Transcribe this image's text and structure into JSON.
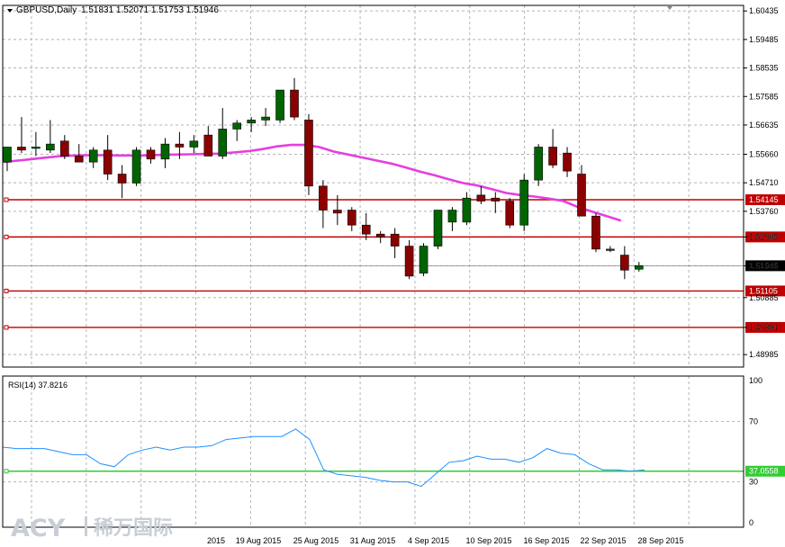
{
  "header": {
    "symbol": "GBPUSD,Daily",
    "ohlc": "1.51831 1.52071 1.51753 1.51946"
  },
  "watermark": {
    "brand": "ACY",
    "cn": "稀万国际"
  },
  "colors": {
    "bull": "#006400",
    "bear": "#8b0000",
    "ma": "#e53fe0",
    "level": "#c00000",
    "rsi": "#1e90ff",
    "rsi_level": "#33cc33",
    "grid": "#b4b4b4",
    "price_label_bg": "#c00000"
  },
  "chart_data": [
    {
      "type": "candlestick",
      "title": "GBPUSD,Daily",
      "y_ticks": [
        "1.60435",
        "1.59485",
        "1.58535",
        "1.57585",
        "1.56635",
        "1.55660",
        "1.54710",
        "1.53760",
        "1.52905",
        "1.51946",
        "1.50885",
        "1.49891",
        "1.48985"
      ],
      "ylim": [
        1.4857,
        1.6062
      ],
      "x_tick_labels": [
        "2015",
        "19 Aug 2015",
        "25 Aug 2015",
        "31 Aug 2015",
        "4 Sep 2015",
        "10 Sep 2015",
        "16 Sep 2015",
        "22 Sep 2015",
        "28 Sep 2015"
      ],
      "candles": [
        {
          "o": 1.554,
          "h": 1.559,
          "l": 1.551,
          "c": 1.559
        },
        {
          "o": 1.559,
          "h": 1.569,
          "l": 1.557,
          "c": 1.558
        },
        {
          "o": 1.559,
          "h": 1.564,
          "l": 1.556,
          "c": 1.559
        },
        {
          "o": 1.558,
          "h": 1.568,
          "l": 1.557,
          "c": 1.56
        },
        {
          "o": 1.561,
          "h": 1.563,
          "l": 1.555,
          "c": 1.556
        },
        {
          "o": 1.556,
          "h": 1.56,
          "l": 1.5545,
          "c": 1.554
        },
        {
          "o": 1.554,
          "h": 1.559,
          "l": 1.552,
          "c": 1.558
        },
        {
          "o": 1.558,
          "h": 1.563,
          "l": 1.548,
          "c": 1.55
        },
        {
          "o": 1.55,
          "h": 1.553,
          "l": 1.542,
          "c": 1.547
        },
        {
          "o": 1.547,
          "h": 1.559,
          "l": 1.546,
          "c": 1.558
        },
        {
          "o": 1.558,
          "h": 1.559,
          "l": 1.5535,
          "c": 1.555
        },
        {
          "o": 1.555,
          "h": 1.562,
          "l": 1.552,
          "c": 1.56
        },
        {
          "o": 1.56,
          "h": 1.564,
          "l": 1.555,
          "c": 1.559
        },
        {
          "o": 1.559,
          "h": 1.563,
          "l": 1.557,
          "c": 1.561
        },
        {
          "o": 1.563,
          "h": 1.566,
          "l": 1.556,
          "c": 1.556
        },
        {
          "o": 1.556,
          "h": 1.572,
          "l": 1.555,
          "c": 1.565
        },
        {
          "o": 1.565,
          "h": 1.568,
          "l": 1.561,
          "c": 1.567
        },
        {
          "o": 1.567,
          "h": 1.569,
          "l": 1.564,
          "c": 1.568
        },
        {
          "o": 1.568,
          "h": 1.572,
          "l": 1.566,
          "c": 1.569
        },
        {
          "o": 1.568,
          "h": 1.578,
          "l": 1.567,
          "c": 1.578
        },
        {
          "o": 1.578,
          "h": 1.582,
          "l": 1.568,
          "c": 1.569
        },
        {
          "o": 1.568,
          "h": 1.57,
          "l": 1.543,
          "c": 1.546
        },
        {
          "o": 1.546,
          "h": 1.548,
          "l": 1.532,
          "c": 1.538
        },
        {
          "o": 1.538,
          "h": 1.543,
          "l": 1.533,
          "c": 1.537
        },
        {
          "o": 1.538,
          "h": 1.539,
          "l": 1.531,
          "c": 1.533
        },
        {
          "o": 1.533,
          "h": 1.537,
          "l": 1.528,
          "c": 1.53
        },
        {
          "o": 1.53,
          "h": 1.531,
          "l": 1.527,
          "c": 1.529
        },
        {
          "o": 1.53,
          "h": 1.532,
          "l": 1.522,
          "c": 1.526
        },
        {
          "o": 1.526,
          "h": 1.528,
          "l": 1.515,
          "c": 1.516
        },
        {
          "o": 1.517,
          "h": 1.527,
          "l": 1.516,
          "c": 1.526
        },
        {
          "o": 1.526,
          "h": 1.538,
          "l": 1.525,
          "c": 1.538
        },
        {
          "o": 1.534,
          "h": 1.539,
          "l": 1.531,
          "c": 1.538
        },
        {
          "o": 1.534,
          "h": 1.544,
          "l": 1.533,
          "c": 1.542
        },
        {
          "o": 1.543,
          "h": 1.546,
          "l": 1.54,
          "c": 1.541
        },
        {
          "o": 1.542,
          "h": 1.544,
          "l": 1.537,
          "c": 1.541
        },
        {
          "o": 1.541,
          "h": 1.542,
          "l": 1.532,
          "c": 1.533
        },
        {
          "o": 1.533,
          "h": 1.55,
          "l": 1.531,
          "c": 1.548
        },
        {
          "o": 1.548,
          "h": 1.56,
          "l": 1.546,
          "c": 1.559
        },
        {
          "o": 1.559,
          "h": 1.565,
          "l": 1.552,
          "c": 1.553
        },
        {
          "o": 1.557,
          "h": 1.559,
          "l": 1.549,
          "c": 1.551
        },
        {
          "o": 1.55,
          "h": 1.553,
          "l": 1.536,
          "c": 1.536
        },
        {
          "o": 1.536,
          "h": 1.537,
          "l": 1.524,
          "c": 1.525
        },
        {
          "o": 1.525,
          "h": 1.526,
          "l": 1.524,
          "c": 1.525
        },
        {
          "o": 1.523,
          "h": 1.526,
          "l": 1.515,
          "c": 1.518
        },
        {
          "o": 1.5183,
          "h": 1.5207,
          "l": 1.5175,
          "c": 1.5195
        }
      ],
      "moving_average": {
        "start_index": 0,
        "values": [
          1.554,
          1.5545,
          1.555,
          1.5555,
          1.556,
          1.5562,
          1.5563,
          1.5563,
          1.5562,
          1.5562,
          1.5562,
          1.5564,
          1.5565,
          1.5566,
          1.5567,
          1.5568,
          1.5572,
          1.5576,
          1.5583,
          1.5592,
          1.5597,
          1.5597,
          1.559,
          1.5575,
          1.5565,
          1.5555,
          1.5545,
          1.5535,
          1.5522,
          1.5508,
          1.5496,
          1.5483,
          1.547,
          1.5462,
          1.545,
          1.5437,
          1.543,
          1.5425,
          1.5418,
          1.541,
          1.539,
          1.5375,
          1.536,
          1.5345
        ]
      },
      "levels": [
        {
          "value": 1.54145,
          "label": "1.54145"
        },
        {
          "value": 1.52905,
          "label": "1.52905"
        },
        {
          "value": 1.51105,
          "label": "1.51105"
        },
        {
          "value": 1.49891,
          "label": "1.49891"
        }
      ],
      "last_price": {
        "value": 1.51946,
        "label": "1.51946"
      }
    },
    {
      "type": "line",
      "title": "RSI(14) 37.8216",
      "ylim": [
        0,
        100
      ],
      "y_ticks": [
        "100",
        "70",
        "30",
        "0"
      ],
      "level": {
        "value": 37.0558,
        "label": "37.0558"
      },
      "values": [
        53,
        52,
        52,
        52,
        50,
        48,
        48,
        42,
        40,
        48,
        51,
        53,
        51,
        53,
        53,
        54,
        58,
        59,
        60,
        60,
        60,
        65,
        58,
        38,
        35,
        34,
        33,
        31,
        30,
        30,
        27,
        35,
        43,
        44,
        47,
        45,
        45,
        43,
        46,
        52,
        49,
        48,
        42,
        38,
        38,
        37,
        38
      ]
    }
  ]
}
